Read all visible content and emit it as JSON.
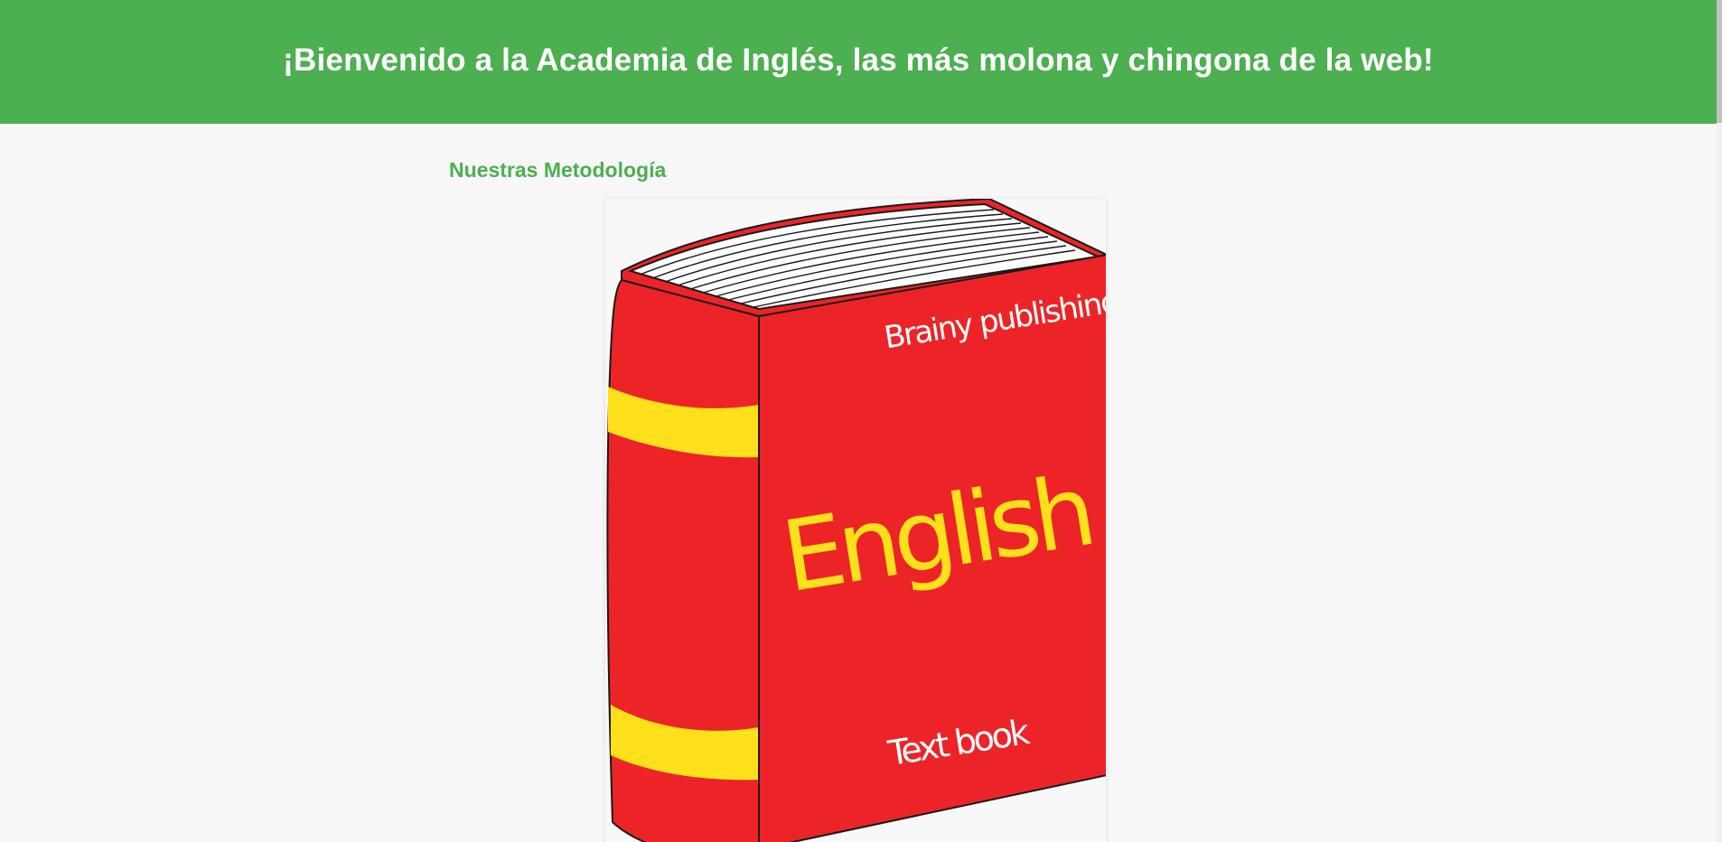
{
  "header": {
    "title": "¡Bienvenido a la Academia de Inglés, las más molona y chingona de la web!"
  },
  "main": {
    "section_title": "Nuestras Metodología",
    "book": {
      "publisher_text": "Brainy publishing",
      "title_text": "English",
      "subtitle_text": "Text book"
    }
  },
  "colors": {
    "header_bg": "#4caf50",
    "accent_green": "#4caf50",
    "book_red": "#ec2427",
    "book_yellow": "#ffe01b",
    "page_bg": "#f7f7f7"
  }
}
